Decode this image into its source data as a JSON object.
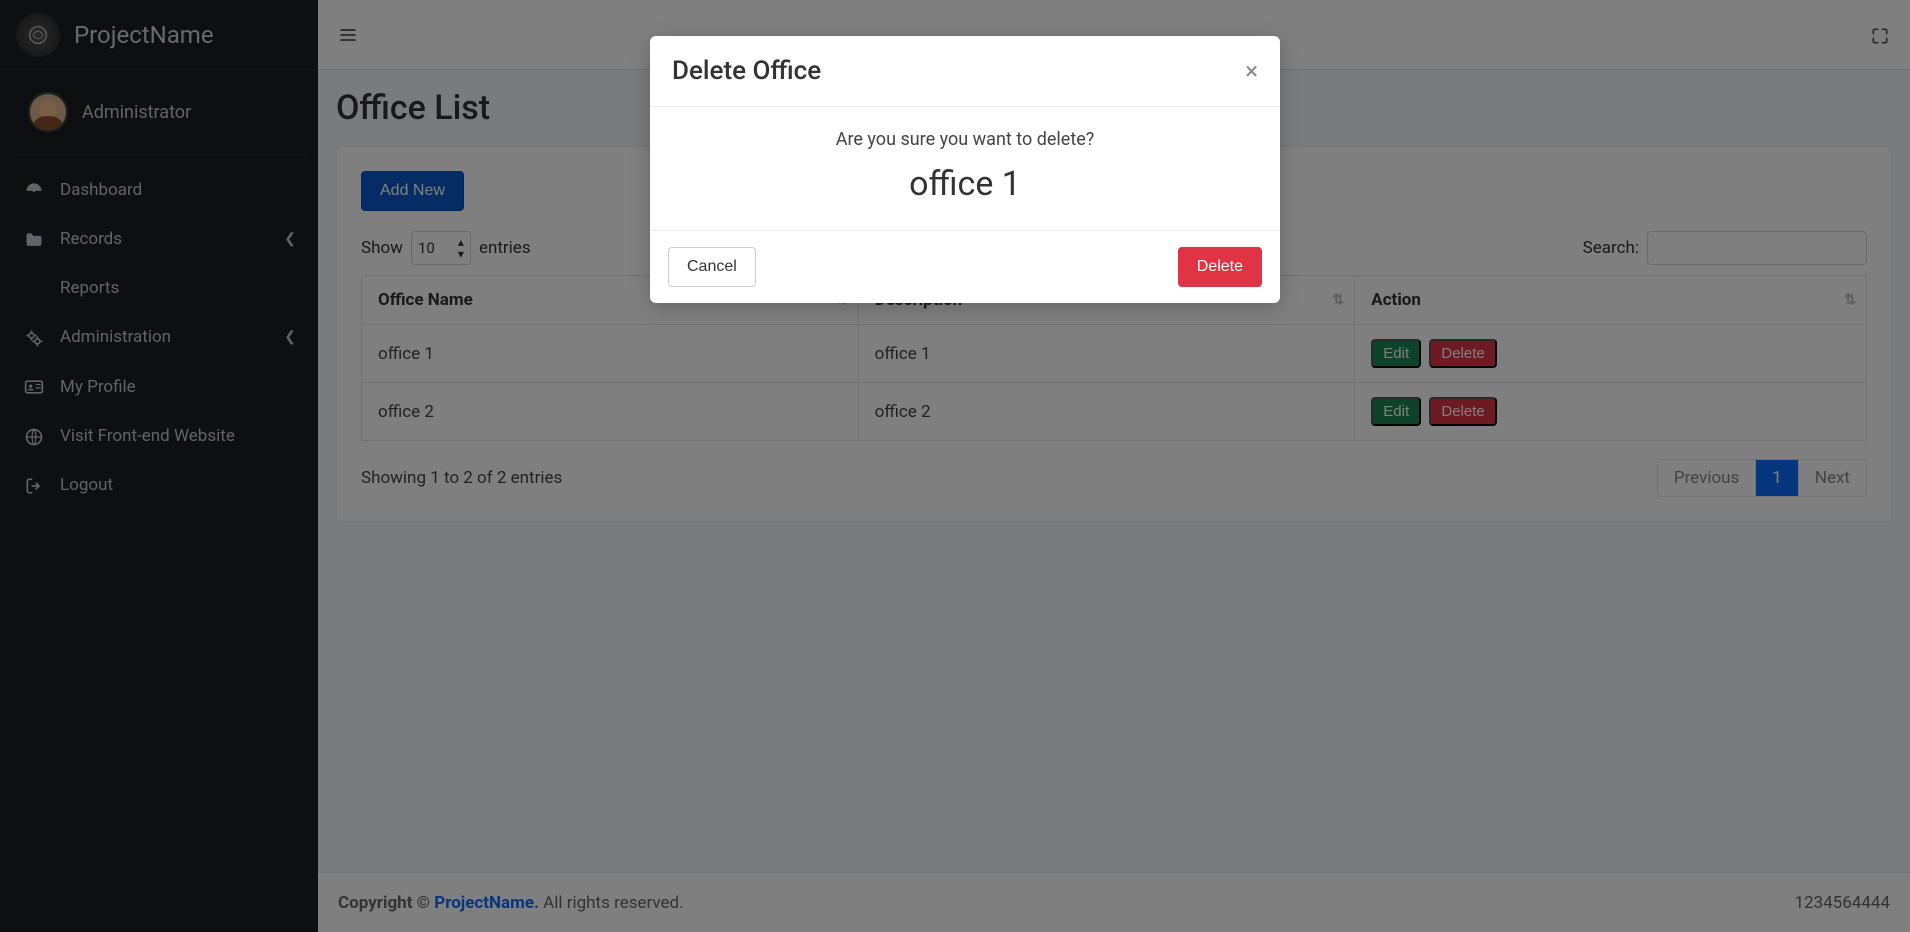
{
  "brand": {
    "name": "ProjectName"
  },
  "user": {
    "name": "Administrator"
  },
  "sidebar": {
    "items": [
      {
        "label": "Dashboard",
        "icon": "dashboard-icon",
        "has_children": false
      },
      {
        "label": "Records",
        "icon": "folder-icon",
        "has_children": true
      },
      {
        "label": "Reports",
        "icon": "chart-icon",
        "has_children": false
      },
      {
        "label": "Administration",
        "icon": "gears-icon",
        "has_children": true
      },
      {
        "label": "My Profile",
        "icon": "id-card-icon",
        "has_children": false
      },
      {
        "label": "Visit Front-end Website",
        "icon": "globe-icon",
        "has_children": false
      },
      {
        "label": "Logout",
        "icon": "logout-icon",
        "has_children": false
      }
    ]
  },
  "page": {
    "title": "Office List"
  },
  "actions": {
    "add_new": "Add New"
  },
  "datatable": {
    "length_label_pre": "Show",
    "length_label_post": "entries",
    "length_value": "10",
    "search_label": "Search:",
    "search_value": "",
    "columns": [
      "Office Name",
      "Description",
      "Action"
    ],
    "rows": [
      {
        "name": "office 1",
        "description": "office 1"
      },
      {
        "name": "office 2",
        "description": "office 2"
      }
    ],
    "row_actions": {
      "edit": "Edit",
      "delete": "Delete"
    },
    "info": "Showing 1 to 2 of 2 entries",
    "pagination": {
      "previous": "Previous",
      "next": "Next",
      "current": "1"
    }
  },
  "footer": {
    "copyright_pre": "Copyright © ",
    "brand": "ProjectName.",
    "rights": " All rights reserved.",
    "right": "1234564444"
  },
  "modal": {
    "title": "Delete Office",
    "confirm_text": "Are you sure you want to delete?",
    "target": "office 1",
    "cancel": "Cancel",
    "delete": "Delete"
  }
}
